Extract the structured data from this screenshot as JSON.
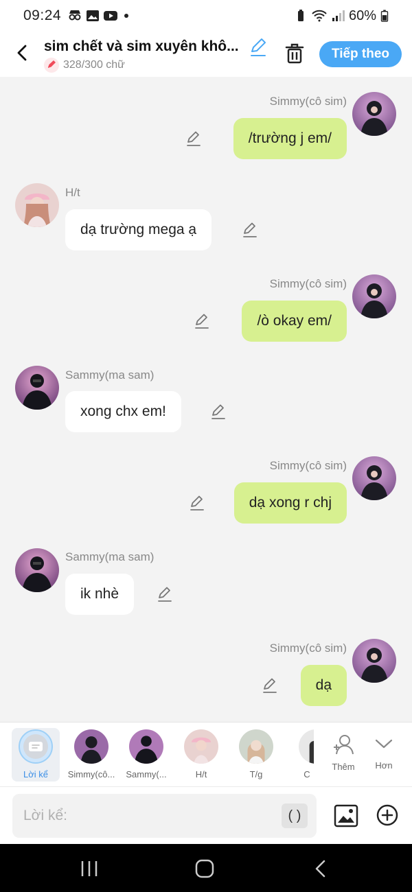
{
  "status": {
    "time": "09:24",
    "battery": "60%"
  },
  "header": {
    "title": "sim chết và sim xuyên khô...",
    "char_count": "328/300 chữ",
    "next_label": "Tiếp theo"
  },
  "messages": [
    {
      "side": "right",
      "sender": "Simmy(cô sim)",
      "text": "/trường j em/",
      "avatar": "purple"
    },
    {
      "side": "left",
      "sender": "H/t",
      "text": "dạ trường mega ạ",
      "avatar": "pink"
    },
    {
      "side": "right",
      "sender": "Simmy(cô sim)",
      "text": "/ò okay em/",
      "avatar": "purple"
    },
    {
      "side": "left",
      "sender": "Sammy(ma sam)",
      "text": "xong chx em!",
      "avatar": "dark"
    },
    {
      "side": "right",
      "sender": "Simmy(cô sim)",
      "text": "dạ xong r chj",
      "avatar": "purple"
    },
    {
      "side": "left",
      "sender": "Sammy(ma sam)",
      "text": "ik nhè",
      "avatar": "dark"
    },
    {
      "side": "right",
      "sender": "Simmy(cô sim)",
      "text": "dạ",
      "avatar": "purple"
    }
  ],
  "characters": [
    {
      "name": "Lời kể"
    },
    {
      "name": "Simmy(cô..."
    },
    {
      "name": "Sammy(..."
    },
    {
      "name": "H/t"
    },
    {
      "name": "T/g"
    },
    {
      "name": "C"
    }
  ],
  "char_actions": {
    "add_label": "Thêm",
    "more_label": "Hơn"
  },
  "input": {
    "placeholder": "Lời kể:",
    "paren_label": "( )"
  },
  "colors": {
    "accent": "#4aa8f5",
    "bubble_right": "#d7f090",
    "bubble_left": "#ffffff"
  }
}
